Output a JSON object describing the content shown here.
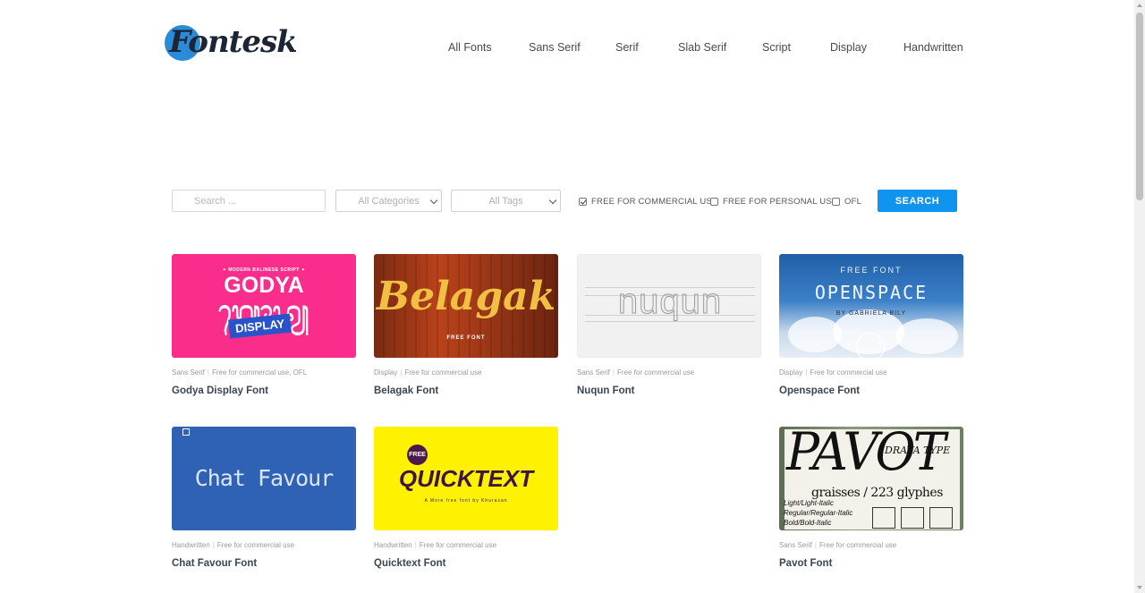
{
  "brand": {
    "logo_text": "Fontesk"
  },
  "nav": {
    "items": [
      {
        "label": "All Fonts"
      },
      {
        "label": "Sans Serif"
      },
      {
        "label": "Serif"
      },
      {
        "label": "Slab Serif"
      },
      {
        "label": "Script"
      },
      {
        "label": "Display"
      },
      {
        "label": "Handwritten"
      }
    ]
  },
  "search": {
    "placeholder": "Search ...",
    "category_select": "All Categories",
    "tags_select": "All Tags",
    "filters": [
      {
        "label": "FREE FOR COMMERCIAL USE",
        "checked": true
      },
      {
        "label": "FREE FOR PERSONAL USE",
        "checked": false
      },
      {
        "label": "OFL",
        "checked": false
      }
    ],
    "button_label": "SEARCH"
  },
  "fonts": [
    {
      "title": "Godya Display Font",
      "category": "Sans Serif",
      "license": "Free for commercial use, OFL",
      "art": {
        "top": "✦ MODERN BALINESE SCRIPT ✦",
        "main": "GODYA",
        "script": "ᬕᭀᬤ᭄ᬬ",
        "tag": "DISPLAY"
      }
    },
    {
      "title": "Belagak Font",
      "category": "Display",
      "license": "Free for commercial use",
      "art": {
        "main": "Belagak",
        "sub": "FREE FONT"
      }
    },
    {
      "title": "Nuqun Font",
      "category": "Sans Serif",
      "license": "Free for commercial use",
      "art": {
        "main": "nuqun"
      }
    },
    {
      "title": "Openspace Font",
      "category": "Display",
      "license": "Free for commercial use",
      "art": {
        "top": "FREE FONT",
        "main": "OPENSPACE",
        "sub": "BY GABRIELA BILY"
      }
    },
    {
      "title": "Chat Favour Font",
      "category": "Handwritten",
      "license": "Free for commercial use",
      "art": {
        "main": "Chat Favour"
      }
    },
    {
      "title": "Quicktext Font",
      "category": "Handwritten",
      "license": "Free for commercial use",
      "art": {
        "badge": "FREE",
        "main": "QUICKTEXT",
        "sub": "A More free font by Khurasan"
      }
    },
    {
      "title": "Pavot Font",
      "category": "Sans Serif",
      "license": "Free for commercial use",
      "art": {
        "main": "PAVOT",
        "brand": "DRAVA TYPE",
        "sub": "graisses / 223 glyphes",
        "w1": "Light/Light-Italic",
        "w2": "Regular/Regular-Italic",
        "w3": "Bold/Bold-Italic"
      }
    }
  ],
  "colors": {
    "accent": "#0f95f0",
    "logo_circle": "#2a8bd8",
    "godya_bg": "#fb2d8c",
    "chat_bg": "#2f62b5",
    "quick_bg": "#fff200"
  }
}
